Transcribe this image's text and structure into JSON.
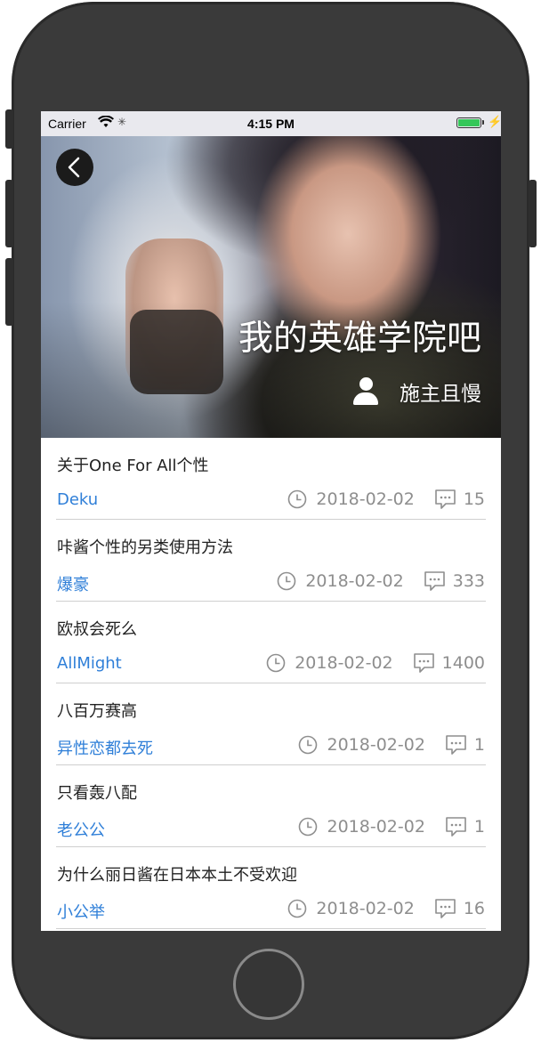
{
  "status_bar": {
    "carrier": "Carrier",
    "time": "4:15 PM",
    "battery_level": 1.0,
    "charging": true
  },
  "header": {
    "back_icon": "back-chevron-icon",
    "title": "我的英雄学院吧",
    "author_icon": "user-icon",
    "author": "施主且慢"
  },
  "posts": [
    {
      "title": "关于One For All个性",
      "author": "Deku",
      "date": "2018-02-02",
      "comments": "15"
    },
    {
      "title": "咔酱个性的另类使用方法",
      "author": "爆豪",
      "date": "2018-02-02",
      "comments": "333"
    },
    {
      "title": "欧叔会死么",
      "author": "AllMight",
      "date": "2018-02-02",
      "comments": "1400"
    },
    {
      "title": "八百万赛高",
      "author": "异性恋都去死",
      "date": "2018-02-02",
      "comments": "1"
    },
    {
      "title": "只看轰八配",
      "author": "老公公",
      "date": "2018-02-02",
      "comments": "1"
    },
    {
      "title": "为什么丽日酱在日本本土不受欢迎",
      "author": "小公举",
      "date": "2018-02-02",
      "comments": "16"
    }
  ],
  "colors": {
    "author_link": "#2f7fd8",
    "meta_gray": "#8e8e8e",
    "phone_body": "#3a3a3a"
  },
  "icons": {
    "time": "clock-icon",
    "comments": "comment-bubble-icon"
  }
}
